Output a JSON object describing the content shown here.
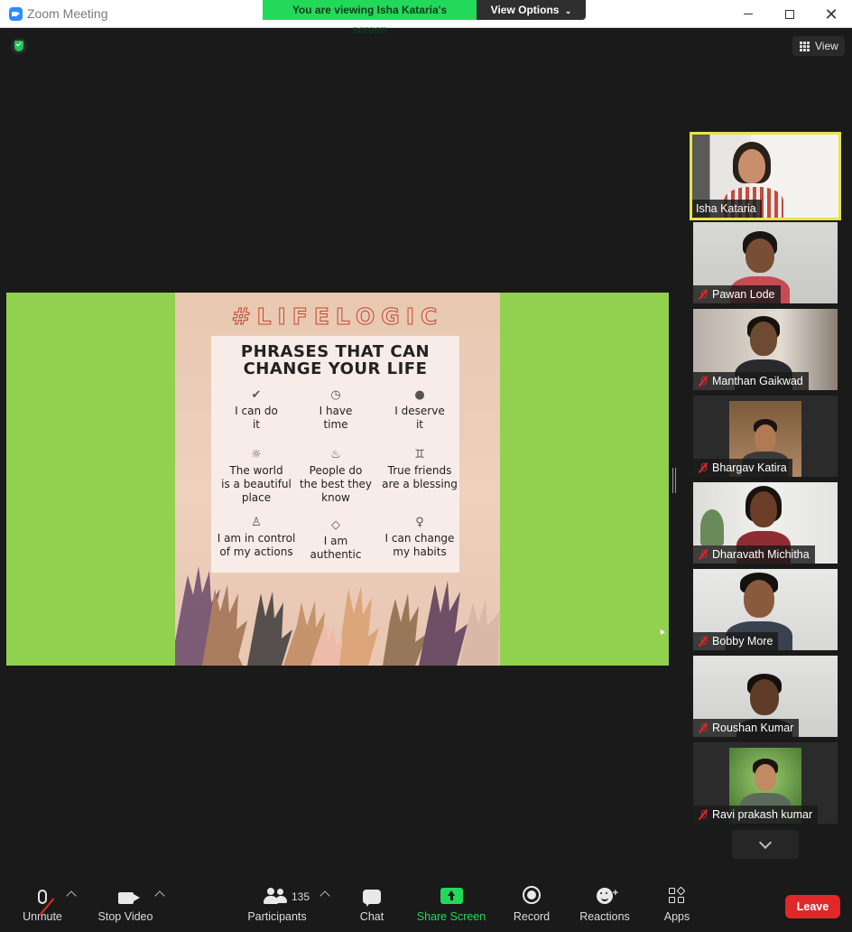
{
  "window": {
    "title": "Zoom Meeting"
  },
  "banner": {
    "text": "You are viewing Isha Kataria's screen",
    "view_options": "View Options"
  },
  "top_right": {
    "view_label": "View"
  },
  "slide": {
    "hashtag": "#LIFELOGIC",
    "title_line1": "PHRASES THAT CAN",
    "title_line2": "CHANGE YOUR LIFE",
    "phrases": [
      {
        "line1": "I can do",
        "line2": "it"
      },
      {
        "line1": "I have",
        "line2": "time"
      },
      {
        "line1": "I deserve",
        "line2": "it"
      },
      {
        "line1": "The world",
        "line2": "is a beautiful",
        "line3": "place"
      },
      {
        "line1": "People do",
        "line2": "the best they",
        "line3": "know"
      },
      {
        "line1": "True friends",
        "line2": "are a blessing"
      },
      {
        "line1": "I am in control",
        "line2": "of my actions"
      },
      {
        "line1": "I am",
        "line2": "authentic"
      },
      {
        "line1": "I can change",
        "line2": "my habits"
      }
    ]
  },
  "participants": [
    {
      "name": "Isha Kataria",
      "muted": false,
      "active": true
    },
    {
      "name": "Pawan Lode",
      "muted": true
    },
    {
      "name": "Manthan Gaikwad",
      "muted": true
    },
    {
      "name": "Bhargav Katira",
      "muted": true
    },
    {
      "name": "Dharavath Michitha",
      "muted": true
    },
    {
      "name": "Bobby More",
      "muted": true
    },
    {
      "name": "Roushan Kumar",
      "muted": true
    },
    {
      "name": "Ravi prakash kumar",
      "muted": true
    }
  ],
  "toolbar": {
    "unmute": "Unmute",
    "stop_video": "Stop Video",
    "participants": "Participants",
    "participants_count": "135",
    "chat": "Chat",
    "share_screen": "Share Screen",
    "record": "Record",
    "reactions": "Reactions",
    "apps": "Apps",
    "leave": "Leave"
  },
  "colors": {
    "share_green": "#23d959",
    "leave_red": "#e02828",
    "active_border": "#e8e24a",
    "slide_bg_green": "#92d050"
  }
}
